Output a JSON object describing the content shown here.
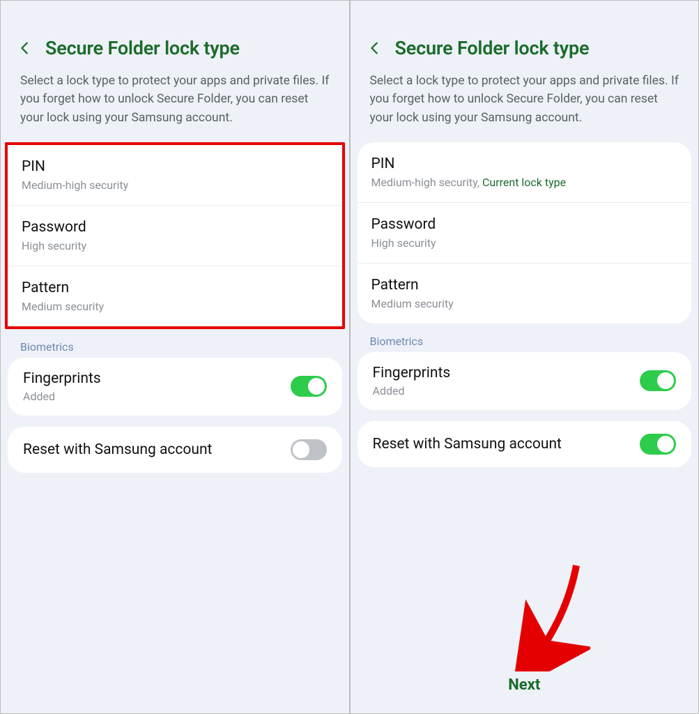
{
  "panes": [
    {
      "title": "Secure Folder lock type",
      "description": "Select a lock type to protect your apps and private files. If you forget how to unlock Secure Folder, you can reset your lock using your Samsung account.",
      "highlight_lock_options": true,
      "lock_options": [
        {
          "title": "PIN",
          "sub": "Medium-high security",
          "current": ""
        },
        {
          "title": "Password",
          "sub": "High security",
          "current": ""
        },
        {
          "title": "Pattern",
          "sub": "Medium security",
          "current": ""
        }
      ],
      "biometrics_label": "Biometrics",
      "fingerprints": {
        "title": "Fingerprints",
        "sub": "Added",
        "toggle": "on"
      },
      "reset": {
        "title": "Reset with Samsung account",
        "toggle": "off"
      },
      "has_next": false,
      "has_arrow": false
    },
    {
      "title": "Secure Folder lock type",
      "description": "Select a lock type to protect your apps and private files. If you forget how to unlock Secure Folder, you can reset your lock using your Samsung account.",
      "highlight_lock_options": false,
      "lock_options": [
        {
          "title": "PIN",
          "sub": "Medium-high security,",
          "current": " Current lock type"
        },
        {
          "title": "Password",
          "sub": "High security",
          "current": ""
        },
        {
          "title": "Pattern",
          "sub": "Medium security",
          "current": ""
        }
      ],
      "biometrics_label": "Biometrics",
      "fingerprints": {
        "title": "Fingerprints",
        "sub": "Added",
        "toggle": "on"
      },
      "reset": {
        "title": "Reset with Samsung account",
        "toggle": "on"
      },
      "has_next": true,
      "next_label": "Next",
      "has_arrow": true
    }
  ]
}
